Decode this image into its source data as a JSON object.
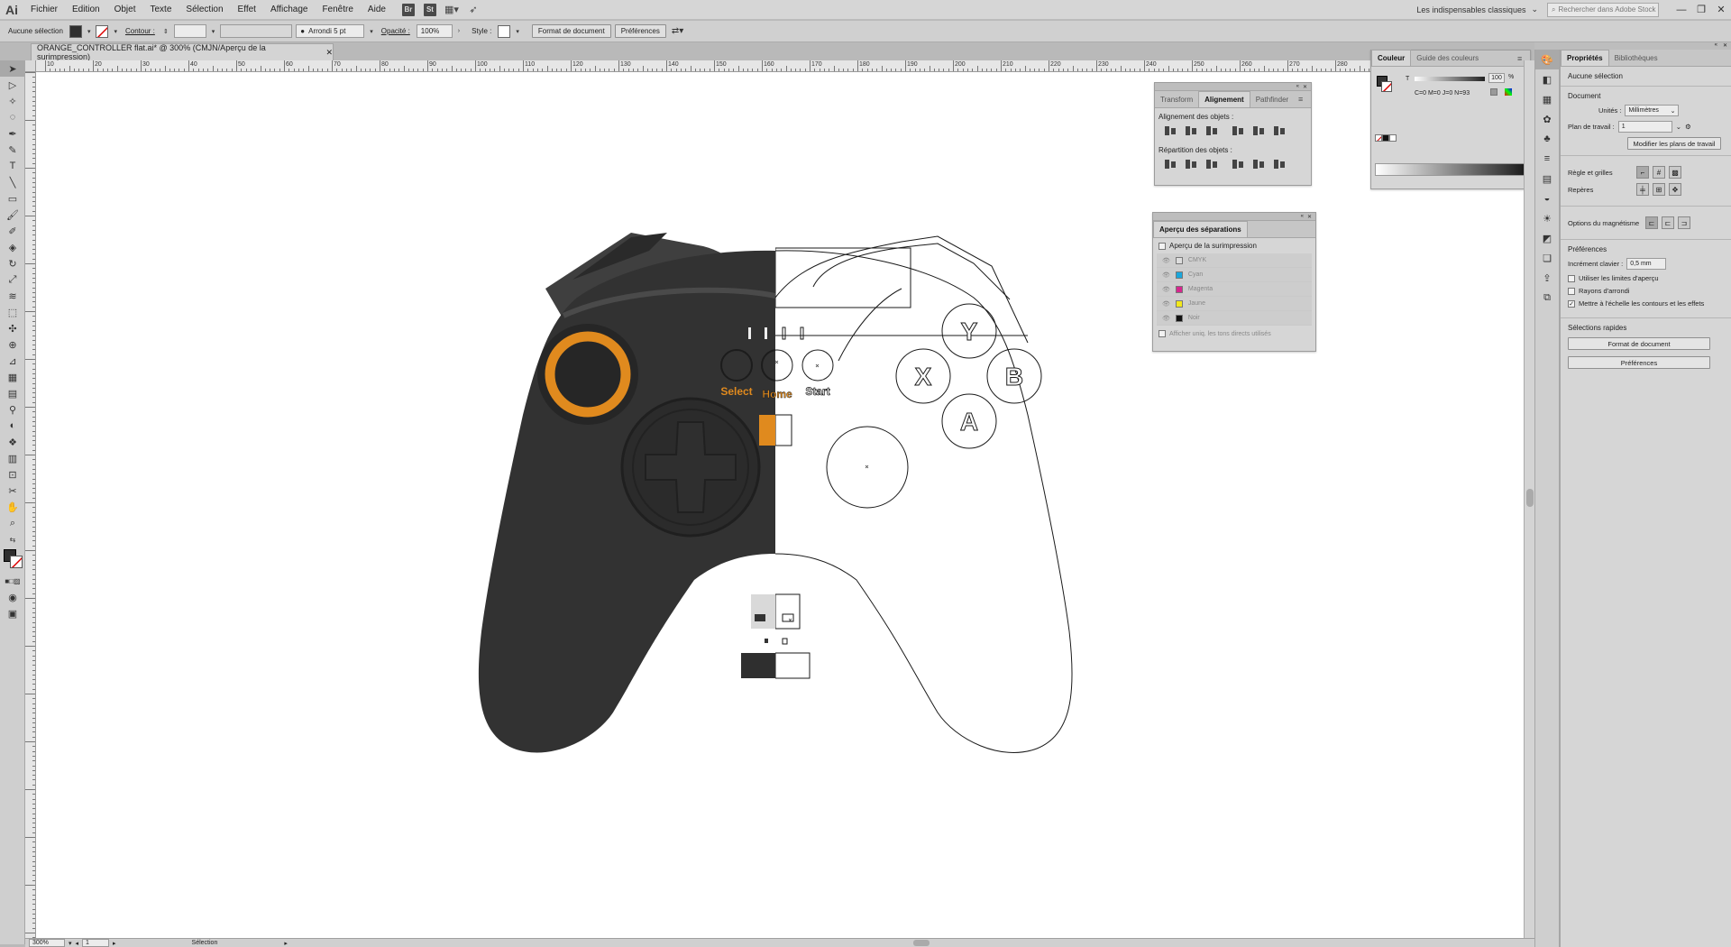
{
  "menubar": {
    "logo": "Ai",
    "items": [
      "Fichier",
      "Edition",
      "Objet",
      "Texte",
      "Sélection",
      "Effet",
      "Affichage",
      "Fenêtre",
      "Aide"
    ],
    "bridge": "Br",
    "stock": "St",
    "workspace": "Les indispensables classiques",
    "search_placeholder": "Rechercher dans Adobe Stock"
  },
  "controlbar": {
    "selection": "Aucune sélection",
    "stroke_label": "Contour :",
    "brush": "Arrondi 5 pt",
    "opacity_label": "Opacité :",
    "opacity_value": "100%",
    "style_label": "Style :",
    "doc_setup": "Format de document",
    "prefs": "Préférences"
  },
  "document": {
    "tab_title": "ORANGE_CONTROLLER flat.ai* @ 300% (CMJN/Aperçu de la surimpression)",
    "zoom": "300%",
    "page": "1",
    "status_tool": "Sélection"
  },
  "ruler": {
    "h_labels": [
      "10",
      "20",
      "30",
      "40",
      "50",
      "60",
      "70",
      "80",
      "90",
      "100",
      "110",
      "120",
      "130",
      "140",
      "150",
      "160",
      "170",
      "180",
      "190",
      "200",
      "210",
      "220",
      "230",
      "240",
      "250",
      "260",
      "270",
      "280",
      "290"
    ]
  },
  "controller": {
    "labels": {
      "select": "Select",
      "home": "Home",
      "start": "Start"
    },
    "buttons": {
      "y": "Y",
      "x": "X",
      "b": "B",
      "a": "A"
    },
    "colors": {
      "body_dark": "#323232",
      "shoulder": "#3f3f3f",
      "accent": "#e08a1e"
    }
  },
  "align_panel": {
    "tabs": [
      "Transform",
      "Alignement",
      "Pathfinder"
    ],
    "active_tab": "Alignement",
    "section1": "Alignement des objets :",
    "section2": "Répartition des objets :"
  },
  "separations_panel": {
    "title": "Aperçu des séparations",
    "overprint": "Aperçu de la surimpression",
    "inks": [
      {
        "name": "CMYK",
        "color": "#dddddd"
      },
      {
        "name": "Cyan",
        "color": "#1aa7dc"
      },
      {
        "name": "Magenta",
        "color": "#d6268e"
      },
      {
        "name": "Jaune",
        "color": "#f2e81a"
      },
      {
        "name": "Noir",
        "color": "#111111"
      }
    ],
    "spot_option": "Afficher uniq. les tons directs utilisés"
  },
  "color_panel": {
    "tabs": [
      "Couleur",
      "Guide des couleurs"
    ],
    "value_label": "T",
    "value": "100",
    "unit": "%",
    "readout": "C=0 M=0 J=0 N=93"
  },
  "properties": {
    "tabs": [
      "Propriétés",
      "Bibliothèques"
    ],
    "no_selection": "Aucune sélection",
    "document_title": "Document",
    "units_label": "Unités :",
    "units_value": "Millimètres",
    "artboard_label": "Plan de travail :",
    "artboard_value": "1",
    "edit_artboards": "Modifier les plans de travail",
    "rulers_label": "Règle et grilles",
    "guides_label": "Repères",
    "snap_label": "Options du magnétisme",
    "prefs_title": "Préférences",
    "key_increment_label": "Incrément clavier :",
    "key_increment_value": "0,5 mm",
    "use_preview_bounds": "Utiliser les limites d'aperçu",
    "scale_corners": "Rayons d'arrondi",
    "scale_strokes": "Mettre à l'échelle les contours et les effets",
    "quick_actions_title": "Sélections rapides",
    "quick_doc_setup": "Format de document",
    "quick_prefs": "Préférences"
  }
}
